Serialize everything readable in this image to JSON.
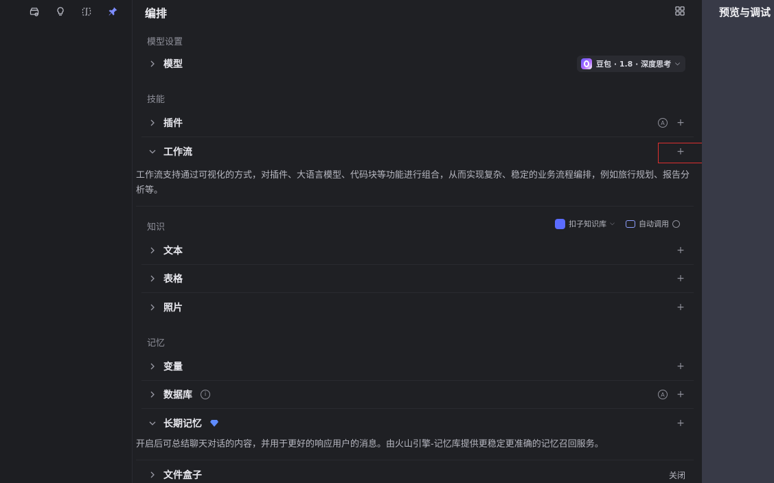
{
  "toolbar": {
    "icons": [
      "agent-icon",
      "bulb-icon",
      "split-icon",
      "pin-icon"
    ]
  },
  "panel": {
    "title": "编排"
  },
  "sections": {
    "model_settings": {
      "label": "模型设置",
      "model_row": {
        "title": "模型",
        "chip": "豆包 · 1.8 · 深度思考"
      }
    },
    "skills": {
      "label": "技能",
      "plugin_row": {
        "title": "插件",
        "badge": "A",
        "add": "+"
      },
      "workflow_row": {
        "title": "工作流",
        "add": "+",
        "description": "工作流支持通过可视化的方式，对插件、大语言模型、代码块等功能进行组合，从而实现复杂、稳定的业务流程编排，例如旅行规划、报告分析等。"
      }
    },
    "knowledge": {
      "label": "知识",
      "kb_name": "扣子知识库",
      "kb_mode": "自动调用",
      "rows": [
        {
          "title": "文本",
          "add": "+"
        },
        {
          "title": "表格",
          "add": "+"
        },
        {
          "title": "照片",
          "add": "+"
        }
      ]
    },
    "memory": {
      "label": "记忆",
      "variable_row": {
        "title": "变量",
        "add": "+"
      },
      "database_row": {
        "title": "数据库",
        "info": "i",
        "badge": "A",
        "add": "+"
      },
      "longterm_row": {
        "title": "长期记忆",
        "add": "+",
        "description": "开启后可总结聊天对话的内容，并用于更好的响应用户的消息。由火山引擎-记忆库提供更稳定更准确的记忆召回服务。"
      },
      "file_box_row": {
        "title": "文件盒子",
        "status": "关闭"
      }
    }
  },
  "right_panel": {
    "title": "预览与调试"
  },
  "colors": {
    "accent": "#7d8dff",
    "highlight": "#e0302f",
    "diamond": "#5f8cff"
  }
}
